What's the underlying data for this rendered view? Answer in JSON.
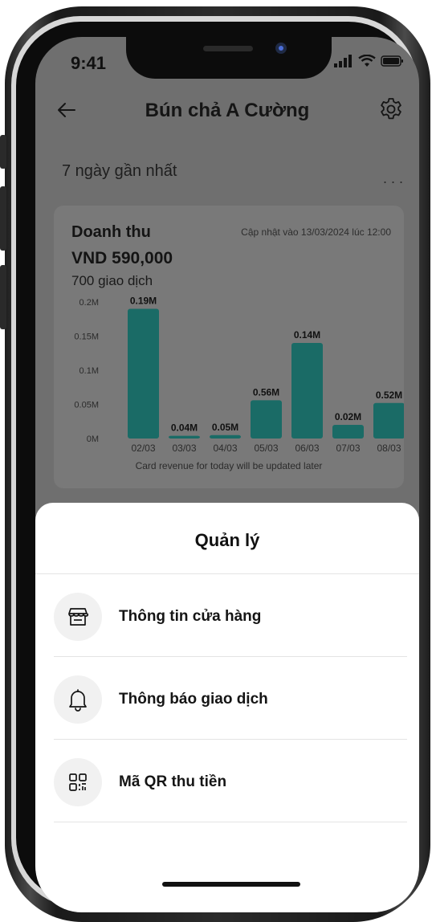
{
  "status_bar": {
    "time": "9:41"
  },
  "header": {
    "title": "Bún chả A Cường"
  },
  "range": {
    "label": "7 ngày gần nhất",
    "more": "..."
  },
  "card": {
    "title": "Doanh thu",
    "updated": "Cập nhật vào 13/03/2024 lúc 12:00",
    "amount": "VND 590,000",
    "transactions": "700 giao dịch",
    "note": "Card revenue for today will be updated later"
  },
  "chart_data": {
    "type": "bar",
    "categories": [
      "02/03",
      "03/03",
      "04/03",
      "05/03",
      "06/03",
      "07/03",
      "08/03"
    ],
    "values": [
      0.19,
      0.004,
      0.005,
      0.056,
      0.14,
      0.02,
      0.052
    ],
    "data_labels": [
      "0.19M",
      "0.04M",
      "0.05M",
      "0.56M",
      "0.14M",
      "0.02M",
      "0.52M"
    ],
    "y_ticks": [
      "0.2M",
      "0.15M",
      "0.1M",
      "0.05M",
      "0M"
    ],
    "ylim": [
      0,
      0.2
    ],
    "bar_color": "#1a6b66",
    "grid": false,
    "title": "",
    "xlabel": "",
    "ylabel": ""
  },
  "sheet": {
    "title": "Quản lý",
    "items": [
      {
        "label": "Thông tin cửa hàng",
        "icon": "store-icon"
      },
      {
        "label": "Thông báo giao dịch",
        "icon": "bell-icon"
      },
      {
        "label": "Mã QR thu tiền",
        "icon": "qr-code-icon"
      }
    ]
  }
}
